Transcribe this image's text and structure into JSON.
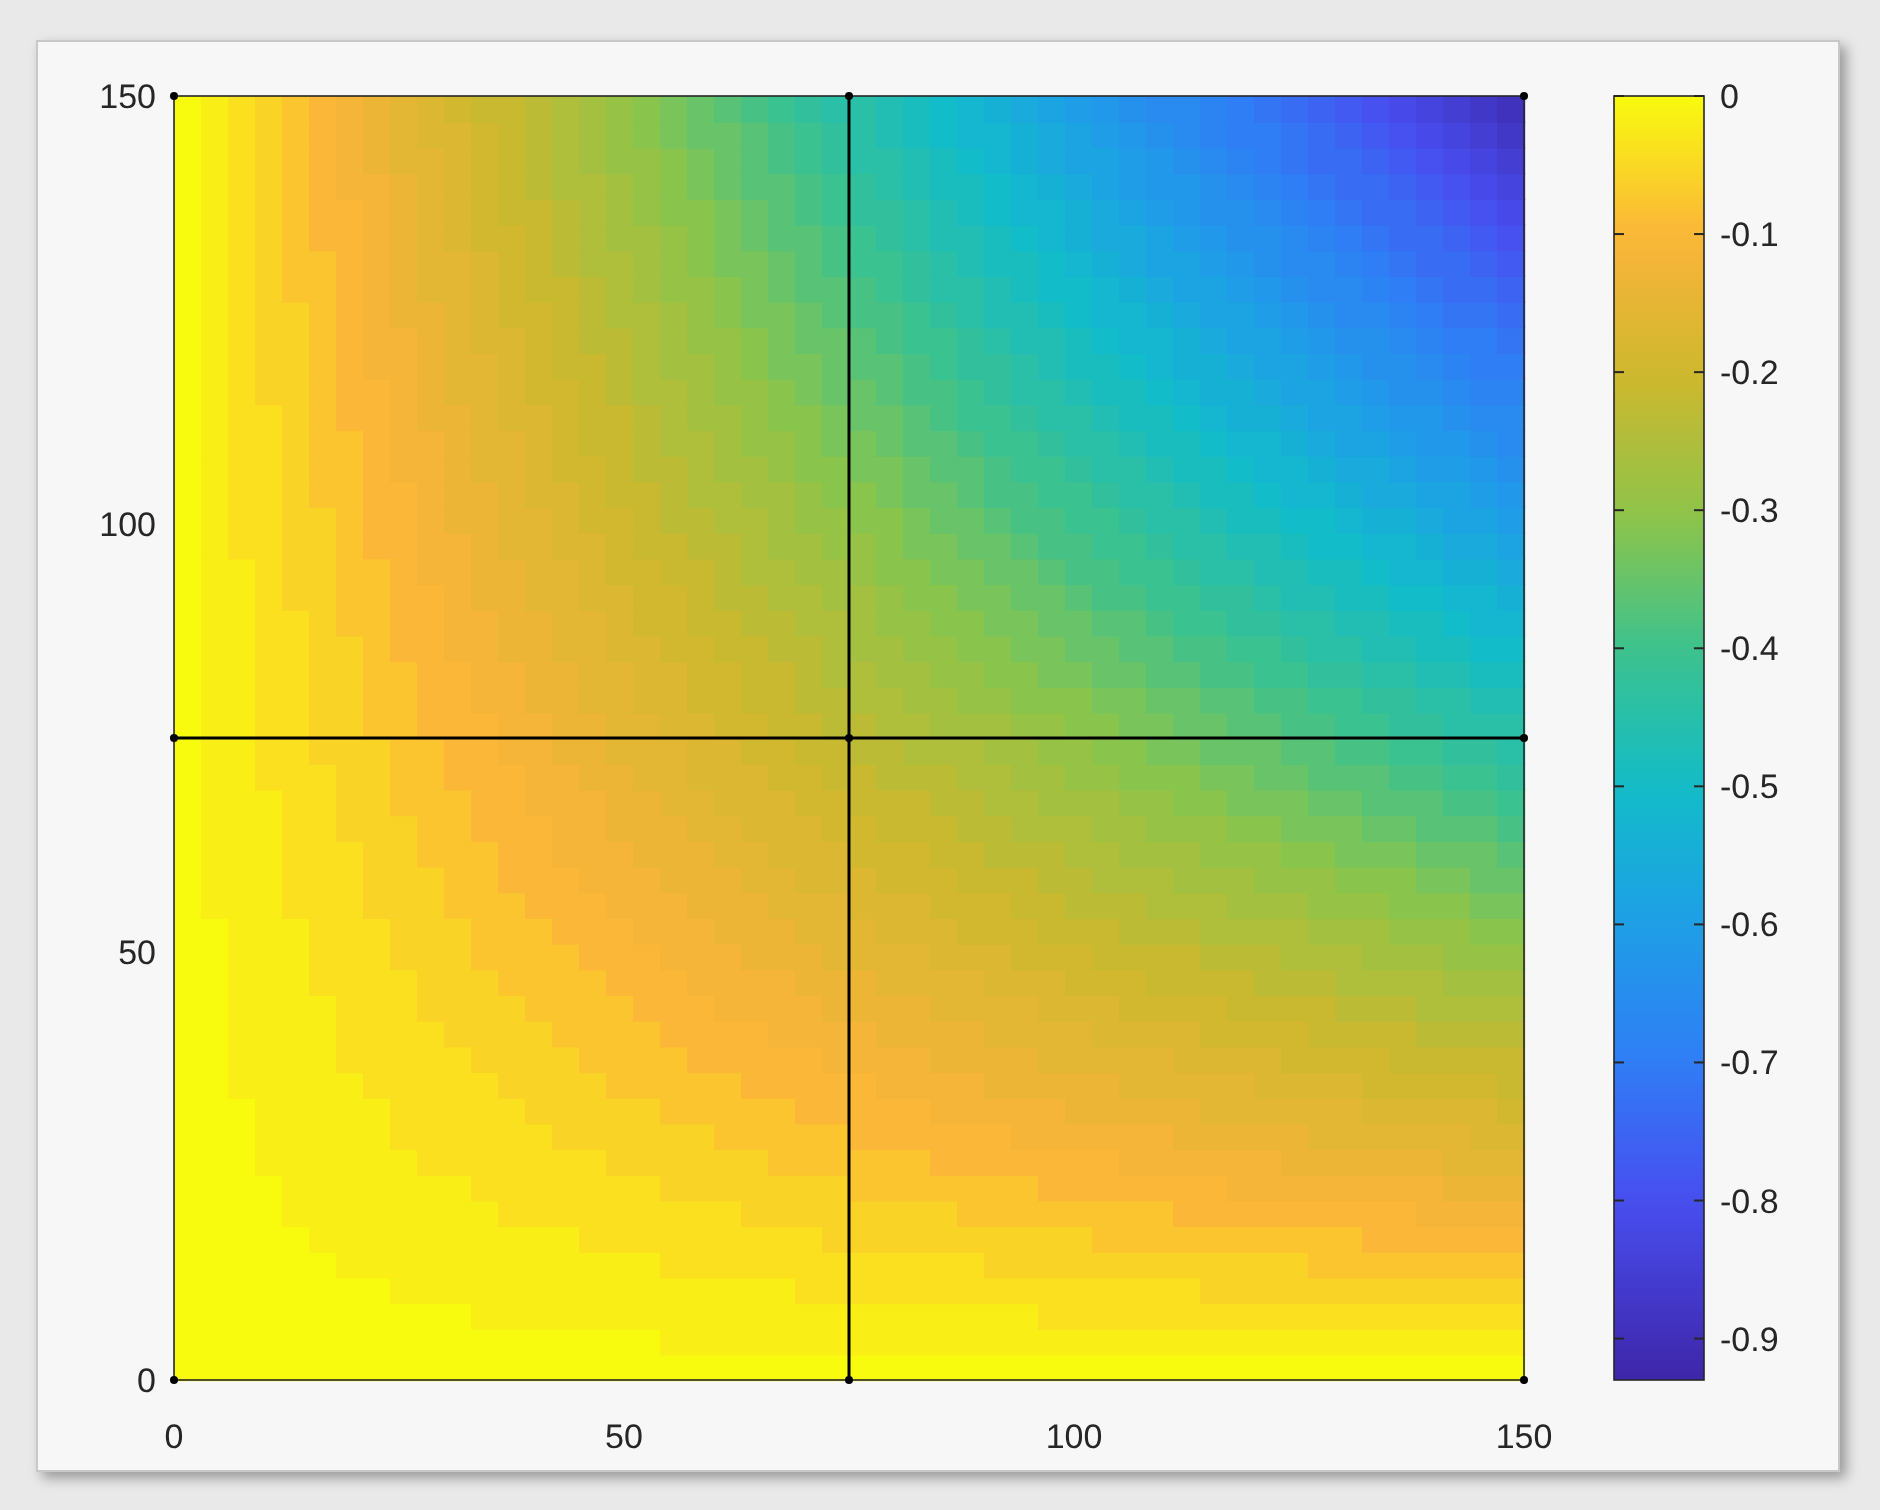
{
  "plot": {
    "x_ticks": [
      "0",
      "50",
      "100",
      "150"
    ],
    "y_ticks": [
      "150",
      "100",
      "50",
      "0"
    ]
  },
  "colorbar": {
    "ticks": [
      "0",
      "-0.1",
      "-0.2",
      "-0.3",
      "-0.4",
      "-0.5",
      "-0.6",
      "-0.7",
      "-0.8",
      "-0.9"
    ]
  }
}
